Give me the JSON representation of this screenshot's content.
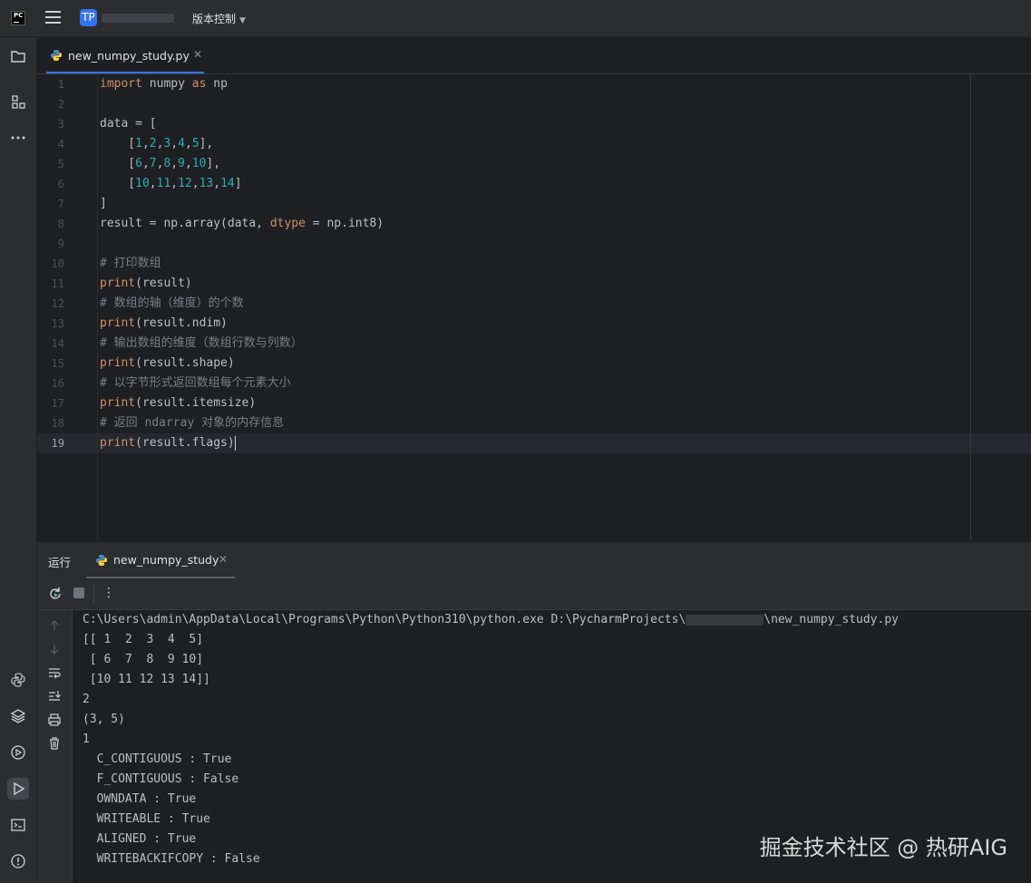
{
  "titlebar": {
    "project_initials": "TP",
    "vcs_label": "版本控制"
  },
  "editor": {
    "tab_name": "new_numpy_study.py",
    "current_line": 19,
    "lines": [
      {
        "n": "1",
        "tokens": [
          {
            "t": "import",
            "c": "kw"
          },
          {
            "t": " numpy ",
            "c": ""
          },
          {
            "t": "as",
            "c": "kw"
          },
          {
            "t": " np",
            "c": ""
          }
        ]
      },
      {
        "n": "2",
        "tokens": []
      },
      {
        "n": "3",
        "tokens": [
          {
            "t": "data = [",
            "c": ""
          }
        ]
      },
      {
        "n": "4",
        "tokens": [
          {
            "t": "    [",
            "c": ""
          },
          {
            "t": "1",
            "c": "num"
          },
          {
            "t": ",",
            "c": ""
          },
          {
            "t": "2",
            "c": "num"
          },
          {
            "t": ",",
            "c": ""
          },
          {
            "t": "3",
            "c": "num"
          },
          {
            "t": ",",
            "c": ""
          },
          {
            "t": "4",
            "c": "num"
          },
          {
            "t": ",",
            "c": ""
          },
          {
            "t": "5",
            "c": "num"
          },
          {
            "t": "],",
            "c": ""
          }
        ]
      },
      {
        "n": "5",
        "tokens": [
          {
            "t": "    [",
            "c": ""
          },
          {
            "t": "6",
            "c": "num"
          },
          {
            "t": ",",
            "c": ""
          },
          {
            "t": "7",
            "c": "num"
          },
          {
            "t": ",",
            "c": ""
          },
          {
            "t": "8",
            "c": "num"
          },
          {
            "t": ",",
            "c": ""
          },
          {
            "t": "9",
            "c": "num"
          },
          {
            "t": ",",
            "c": ""
          },
          {
            "t": "10",
            "c": "num"
          },
          {
            "t": "],",
            "c": ""
          }
        ]
      },
      {
        "n": "6",
        "tokens": [
          {
            "t": "    [",
            "c": ""
          },
          {
            "t": "10",
            "c": "num"
          },
          {
            "t": ",",
            "c": ""
          },
          {
            "t": "11",
            "c": "num"
          },
          {
            "t": ",",
            "c": ""
          },
          {
            "t": "12",
            "c": "num"
          },
          {
            "t": ",",
            "c": ""
          },
          {
            "t": "13",
            "c": "num"
          },
          {
            "t": ",",
            "c": ""
          },
          {
            "t": "14",
            "c": "num"
          },
          {
            "t": "]",
            "c": ""
          }
        ]
      },
      {
        "n": "7",
        "tokens": [
          {
            "t": "]",
            "c": ""
          }
        ]
      },
      {
        "n": "8",
        "tokens": [
          {
            "t": "result = np.array(data, ",
            "c": ""
          },
          {
            "t": "dtype",
            "c": "ora"
          },
          {
            "t": " = np.int8)",
            "c": ""
          }
        ]
      },
      {
        "n": "9",
        "tokens": []
      },
      {
        "n": "10",
        "tokens": [
          {
            "t": "# 打印数组",
            "c": "cm"
          }
        ]
      },
      {
        "n": "11",
        "tokens": [
          {
            "t": "print",
            "c": "kw"
          },
          {
            "t": "(result)",
            "c": ""
          }
        ]
      },
      {
        "n": "12",
        "tokens": [
          {
            "t": "# 数组的轴（维度）的个数",
            "c": "cm"
          }
        ]
      },
      {
        "n": "13",
        "tokens": [
          {
            "t": "print",
            "c": "kw"
          },
          {
            "t": "(result.ndim)",
            "c": ""
          }
        ]
      },
      {
        "n": "14",
        "tokens": [
          {
            "t": "# 输出数组的维度（数组行数与列数）",
            "c": "cm"
          }
        ]
      },
      {
        "n": "15",
        "tokens": [
          {
            "t": "print",
            "c": "kw"
          },
          {
            "t": "(result.shape)",
            "c": ""
          }
        ]
      },
      {
        "n": "16",
        "tokens": [
          {
            "t": "# 以字节形式返回数组每个元素大小",
            "c": "cm"
          }
        ]
      },
      {
        "n": "17",
        "tokens": [
          {
            "t": "print",
            "c": "kw"
          },
          {
            "t": "(result.itemsize)",
            "c": ""
          }
        ]
      },
      {
        "n": "18",
        "tokens": [
          {
            "t": "# 返回 ndarray 对象的内存信息",
            "c": "cm"
          }
        ]
      },
      {
        "n": "19",
        "tokens": [
          {
            "t": "print",
            "c": "kw"
          },
          {
            "t": "(result.flags)",
            "c": ""
          }
        ]
      }
    ]
  },
  "run": {
    "label": "运行",
    "tab_name": "new_numpy_study",
    "command_prefix": "C:\\Users\\admin\\AppData\\Local\\Programs\\Python\\Python310\\python.exe D:\\PycharmProjects\\",
    "command_suffix": "\\new_numpy_study.py",
    "output": [
      "[[ 1  2  3  4  5]",
      " [ 6  7  8  9 10]",
      " [10 11 12 13 14]]",
      "2",
      "(3, 5)",
      "1",
      "  C_CONTIGUOUS : True",
      "  F_CONTIGUOUS : False",
      "  OWNDATA : True",
      "  WRITEABLE : True",
      "  ALIGNED : True",
      "  WRITEBACKIFCOPY : False"
    ]
  },
  "watermark": "掘金技术社区 @ 热研AIG"
}
